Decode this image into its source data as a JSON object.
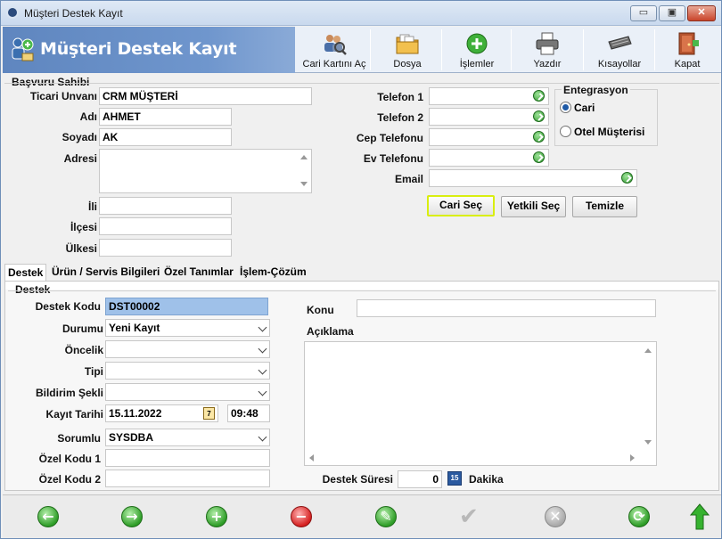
{
  "window": {
    "title": "Müşteri Destek Kayıt",
    "min_label": "▭",
    "max_label": "▣",
    "close_label": "✕"
  },
  "header": {
    "title": "Müşteri Destek Kayıt"
  },
  "toolbar": [
    {
      "label": "Cari Kartını Aç",
      "icon": "people-search-icon"
    },
    {
      "label": "Dosya",
      "icon": "folder-icon"
    },
    {
      "label": "İşlemler",
      "icon": "plus-circle-icon"
    },
    {
      "label": "Yazdır",
      "icon": "printer-icon"
    },
    {
      "label": "Kısayollar",
      "icon": "keyboard-icon"
    },
    {
      "label": "Kapat",
      "icon": "exit-door-icon"
    }
  ],
  "applicant": {
    "section_title": "Başvuru Sahibi",
    "trade_name_label": "Ticari Unvanı",
    "trade_name": "CRM MÜŞTERİ",
    "name_label": "Adı",
    "name": "AHMET",
    "surname_label": "Soyadı",
    "surname": "AK",
    "address_label": "Adresi",
    "address": "",
    "city_label": "İli",
    "city": "",
    "district_label": "İlçesi",
    "district": "",
    "country_label": "Ülkesi",
    "country": "",
    "phone1_label": "Telefon 1",
    "phone1": "",
    "phone2_label": "Telefon 2",
    "phone2": "",
    "mobile_label": "Cep Telefonu",
    "mobile": "",
    "home_phone_label": "Ev Telefonu",
    "home_phone": "",
    "email_label": "Email",
    "email": ""
  },
  "integration": {
    "title": "Entegrasyon",
    "options": [
      "Cari",
      "Otel Müşterisi"
    ],
    "selected": "Cari"
  },
  "actions": {
    "select_account": "Cari Seç",
    "select_authorized": "Yetkili Seç",
    "clear": "Temizle"
  },
  "tabs": [
    "Destek",
    "Ürün / Servis Bilgileri",
    "Özel Tanımlar",
    "İşlem-Çözüm"
  ],
  "support": {
    "section_title": "Destek",
    "code_label": "Destek Kodu",
    "code": "DST00002",
    "status_label": "Durumu",
    "status": "Yeni Kayıt",
    "priority_label": "Öncelik",
    "priority": "",
    "type_label": "Tipi",
    "type": "",
    "notify_label": "Bildirim Şekli",
    "notify": "",
    "date_label": "Kayıt Tarihi",
    "date": "15.11.2022",
    "time": "09:48",
    "calendar_day": "7",
    "owner_label": "Sorumlu",
    "owner": "SYSDBA",
    "special1_label": "Özel Kodu 1",
    "special1": "",
    "special2_label": "Özel Kodu 2",
    "special2": "",
    "subject_label": "Konu",
    "subject": "",
    "description_label": "Açıklama",
    "description": "",
    "duration_label": "Destek Süresi",
    "duration": "0",
    "duration_unit": "Dakika",
    "duration_icon_text": "15"
  },
  "footer": {
    "icons": [
      "prev-icon",
      "next-icon",
      "add-icon",
      "delete-icon",
      "edit-icon",
      "confirm-icon",
      "cancel-icon",
      "refresh-icon",
      "exit-icon"
    ]
  },
  "colors": {
    "header_banner": "#6f96cd",
    "focus_border": "#d9ee10",
    "selected_field": "#9fc1e9"
  }
}
